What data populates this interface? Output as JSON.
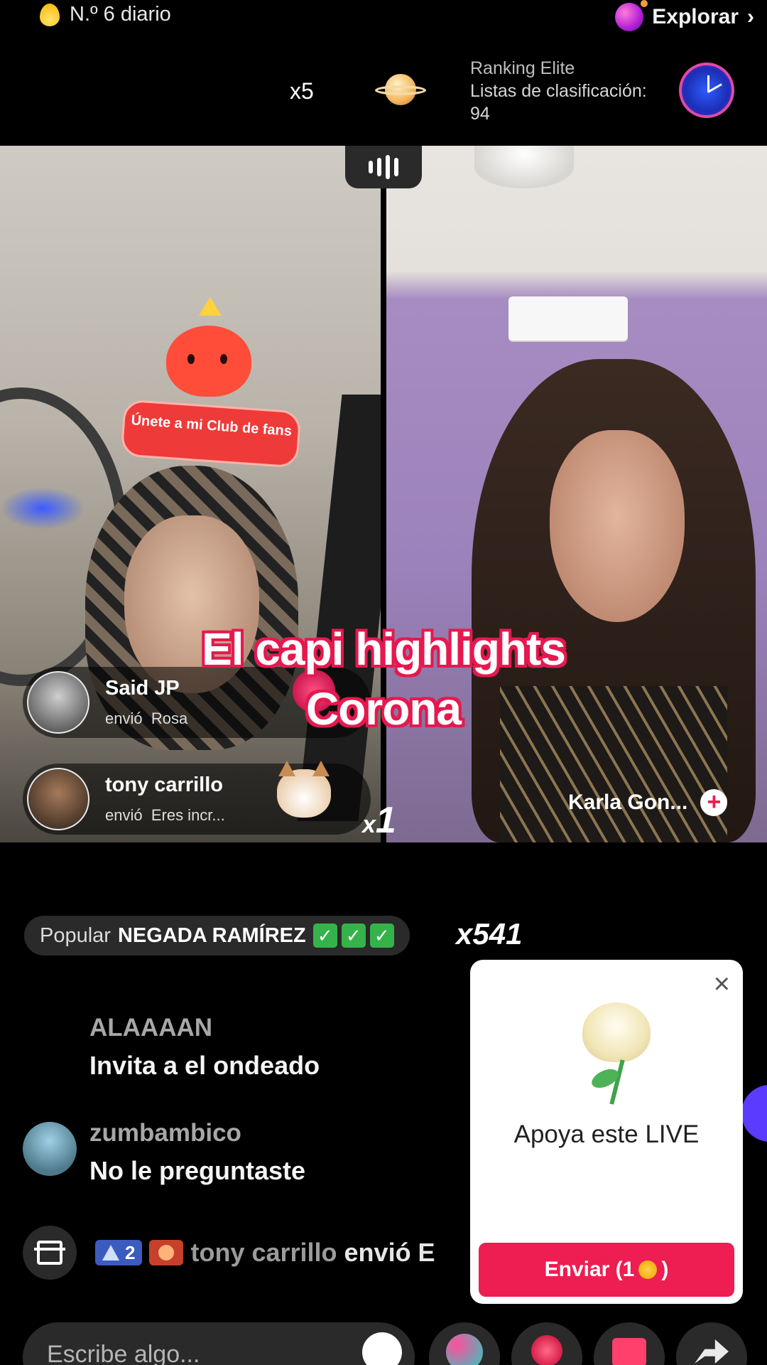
{
  "header": {
    "daily_rank": "N.º 6 diario",
    "explore_label": "Explorar",
    "explore_chevron": "›",
    "multiplier": "x5",
    "ranking_title": "Ranking Elite",
    "ranking_label": "Listas de clasificación:",
    "ranking_value": "94"
  },
  "stream": {
    "left_sticker_text": "Únete a mi Club de fans",
    "right_host_name": "Karla Gon...",
    "follow_symbol": "+",
    "gift_multiplier_prefix": "x",
    "gift_multiplier_value": "1",
    "caption_line1": "El capi highlights",
    "caption_line2": "Corona"
  },
  "gift_notifications": [
    {
      "user": "Said JP",
      "verb": "envió",
      "gift": "Rosa",
      "icon": "rose-icon"
    },
    {
      "user": "tony carrillo",
      "verb": "envió",
      "gift": "Eres incr...",
      "icon": "cat-icon"
    }
  ],
  "popular": {
    "label": "Popular",
    "name": "NEGADA RAMÍREZ",
    "checks": [
      "✓",
      "✓",
      "✓"
    ],
    "combo": "x541"
  },
  "chat": [
    {
      "user": "ALAAAAN",
      "message": "Invita a el ondeado"
    },
    {
      "user": "zumbambico",
      "message": "No le preguntaste"
    }
  ],
  "system_line": {
    "level": "2",
    "user": "tony carrillo",
    "action": "envió E"
  },
  "support_popup": {
    "close_symbol": "×",
    "title": "Apoya este LIVE",
    "send_label_prefix": "Enviar (1",
    "send_label_suffix": ")"
  },
  "bottom_bar": {
    "input_placeholder": "Escribe algo..."
  },
  "colors": {
    "accent": "#ee1d52",
    "caption_outline": "#e5194f",
    "background": "#000000",
    "pill": "#2a2a2a"
  }
}
